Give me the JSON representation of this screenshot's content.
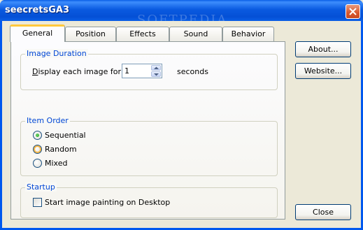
{
  "window": {
    "title": "seecretsGA3",
    "watermark": "SOFTPEDIA"
  },
  "tabs": [
    {
      "label": "General",
      "active": true
    },
    {
      "label": "Position",
      "active": false
    },
    {
      "label": "Effects",
      "active": false
    },
    {
      "label": "Sound",
      "active": false
    },
    {
      "label": "Behavior",
      "active": false
    }
  ],
  "image_duration": {
    "title": "Image Duration",
    "label_prefix": "D",
    "label_rest": "isplay each image for",
    "value": "1",
    "unit": "seconds"
  },
  "item_order": {
    "title": "Item Order",
    "options": [
      {
        "label": "Sequential",
        "selected": true
      },
      {
        "label": "Random",
        "selected": false
      },
      {
        "label": "Mixed",
        "selected": false
      }
    ]
  },
  "startup": {
    "title": "Startup",
    "checkbox_label": "Start image painting on Desktop",
    "checked": false
  },
  "buttons": {
    "about": "About...",
    "website": "Website...",
    "close": "Close"
  },
  "colors": {
    "titlebar": "#0450d6",
    "group_title": "#0046d5",
    "active_tab_accent": "#ffc83c",
    "face": "#ece9d8"
  }
}
